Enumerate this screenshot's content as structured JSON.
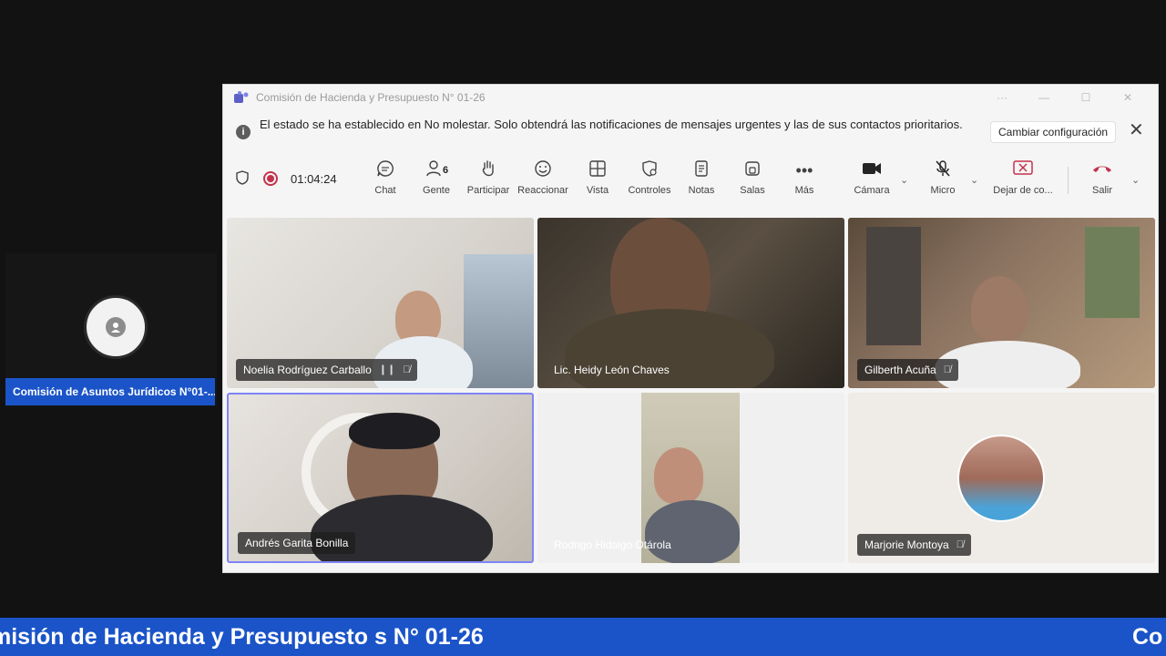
{
  "left_panel": {
    "participant_name": "Comisión de Asuntos Jurídicos N°01-..."
  },
  "window": {
    "title": "Comisión de Hacienda y Presupuesto N° 01-26",
    "controls": [
      "···",
      "—",
      "☐",
      "✕"
    ]
  },
  "notification": {
    "message": "El estado se ha establecido en No molestar. Solo obtendrá las notificaciones de mensajes urgentes y las de sus contactos prioritarios.",
    "button": "Cambiar configuración"
  },
  "toolbar": {
    "timer": "01:04:24",
    "people_count": "6",
    "buttons": {
      "chat": "Chat",
      "people": "Gente",
      "raise": "Participar",
      "react": "Reaccionar",
      "view": "Vista",
      "controls": "Controles",
      "notes": "Notas",
      "rooms": "Salas",
      "more": "Más",
      "camera": "Cámara",
      "mic": "Micro",
      "share": "Dejar de co...",
      "leave": "Salir"
    }
  },
  "participants": [
    {
      "name": "Noelia Rodríguez Carballo"
    },
    {
      "name": "Lic. Heidy León Chaves"
    },
    {
      "name": "Gilberth Acuña"
    },
    {
      "name": "Andrés Garita Bonilla"
    },
    {
      "name": "Rodrigo Hidalgo Otárola"
    },
    {
      "name": "Marjorie Montoya"
    }
  ],
  "ticker": {
    "main": "misión de Hacienda y Presupuesto s N° 01-26",
    "next": "Co"
  },
  "colors": {
    "accent": "#1b54c8",
    "record": "#c4314b",
    "leave": "#c4314b",
    "teams": "#5b5fc7"
  }
}
